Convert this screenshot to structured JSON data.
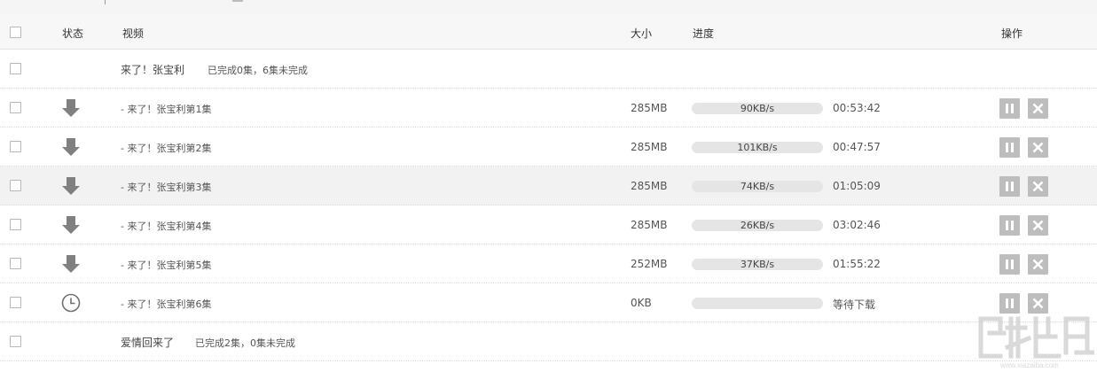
{
  "header": {
    "status": "状态",
    "video": "视频",
    "size": "大小",
    "progress": "进度",
    "actions": "操作"
  },
  "groups": [
    {
      "title": "来了！张宝利",
      "status_text": "已完成0集，6集未完成"
    },
    {
      "title": "爱情回来了",
      "status_text": "已完成2集，0集未完成"
    }
  ],
  "items": [
    {
      "name": "- 来了！张宝利第1集",
      "size": "285MB",
      "speed": "90KB/s",
      "time": "00:53:42",
      "state": "downloading",
      "state_icon": "download-arrow-icon"
    },
    {
      "name": "- 来了！张宝利第2集",
      "size": "285MB",
      "speed": "101KB/s",
      "time": "00:47:57",
      "state": "downloading",
      "state_icon": "download-arrow-icon"
    },
    {
      "name": "- 来了！张宝利第3集",
      "size": "285MB",
      "speed": "74KB/s",
      "time": "01:05:09",
      "state": "downloading",
      "state_icon": "download-arrow-icon"
    },
    {
      "name": "- 来了！张宝利第4集",
      "size": "285MB",
      "speed": "26KB/s",
      "time": "03:02:46",
      "state": "downloading",
      "state_icon": "download-arrow-icon"
    },
    {
      "name": "- 来了！张宝利第5集",
      "size": "252MB",
      "speed": "37KB/s",
      "time": "01:55:22",
      "state": "downloading",
      "state_icon": "download-arrow-icon"
    },
    {
      "name": "- 来了！张宝利第6集",
      "size": "0KB",
      "speed": "",
      "time": "等待下载",
      "state": "waiting",
      "state_icon": "clock-icon"
    }
  ],
  "colors": {
    "icon_gray": "#808080",
    "button_gray": "#bdbdbd",
    "progress_track": "#e5e5e5",
    "highlight_row": "#f2f2f2"
  }
}
